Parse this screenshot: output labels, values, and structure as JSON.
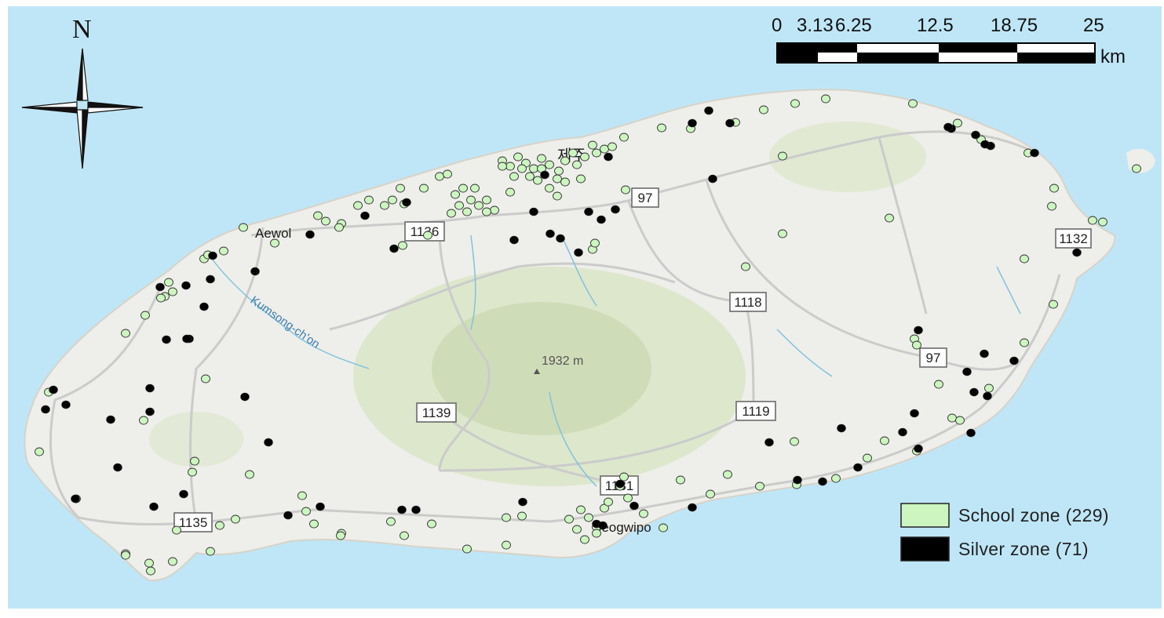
{
  "map": {
    "north_label": "N",
    "unit": "km",
    "scale_ticks": [
      "0",
      "3.13",
      "6.25",
      "12.5",
      "18.75",
      "25"
    ],
    "colors": {
      "sea": "#bfe6f7",
      "land": "#eeeeea",
      "mountain": "#dce6c9",
      "road": "#cfcfcf",
      "school_zone": "#ccf5c0",
      "silver_zone": "#000000"
    }
  },
  "places": {
    "aewol": "Aewol",
    "jeju": "제주",
    "seogwipo": "Seogwipo",
    "peak": "1932 m",
    "river": "Kumsong-ch'on"
  },
  "road_shields": [
    "97",
    "1136",
    "1132",
    "1118",
    "97",
    "1139",
    "1119",
    "1131",
    "1135"
  ],
  "legend": {
    "school": "School zone (229)",
    "silver": "Silver zone (71)"
  }
}
